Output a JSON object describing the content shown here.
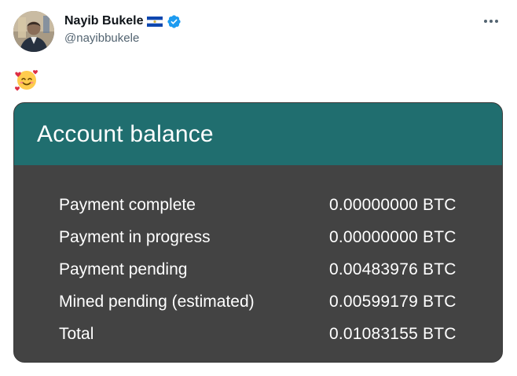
{
  "author": {
    "display_name": "Nayib Bukele",
    "handle": "@nayibbukele",
    "flag_icon": "el-salvador-flag-icon",
    "verified_icon": "verified-badge-icon"
  },
  "tweet": {
    "emoji": "smiling-face-with-hearts-icon"
  },
  "card": {
    "title": "Account balance",
    "rows": [
      {
        "label": "Payment complete",
        "value": "0.00000000 BTC"
      },
      {
        "label": "Payment in progress",
        "value": "0.00000000 BTC"
      },
      {
        "label": "Payment pending",
        "value": "0.00483976 BTC"
      },
      {
        "label": "Mined pending (estimated)",
        "value": "0.00599179 BTC"
      },
      {
        "label": "Total",
        "value": "0.01083155 BTC"
      }
    ]
  },
  "colors": {
    "card_header": "#206e6f",
    "card_body": "#434343",
    "verified_blue": "#1d9bf0",
    "handle_gray": "#536471"
  }
}
